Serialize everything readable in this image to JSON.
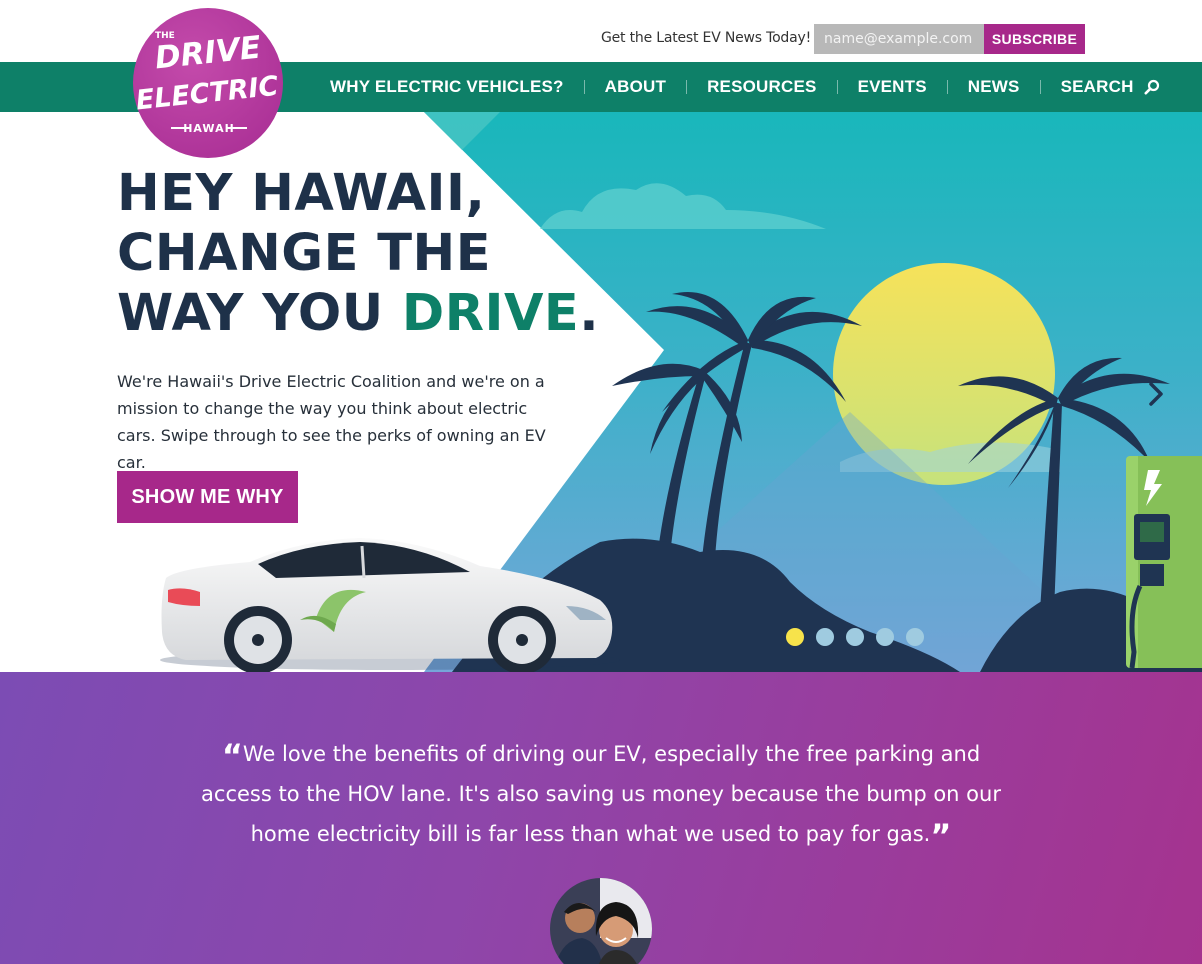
{
  "topbar": {
    "news_label": "Get the Latest EV News Today!",
    "email_placeholder": "name@example.com",
    "subscribe_label": "SUBSCRIBE"
  },
  "logo": {
    "line1": "DRIVE",
    "line2": "ELECTRIC",
    "line3": "HAWAII"
  },
  "nav": {
    "items": [
      {
        "label": "WHY ELECTRIC VEHICLES?"
      },
      {
        "label": "ABOUT"
      },
      {
        "label": "RESOURCES"
      },
      {
        "label": "EVENTS"
      },
      {
        "label": "NEWS"
      },
      {
        "label": "SEARCH"
      }
    ]
  },
  "hero": {
    "title_line1": "HEY HAWAII,",
    "title_line2": "CHANGE THE",
    "title_line3_a": "WAY YOU ",
    "title_line3_accent": "DRIVE",
    "title_line3_b": ".",
    "body": "We're Hawaii's Drive Electric Coalition and we're on a mission to change the way you think about electric cars. Swipe through to see the perks of owning an EV car.",
    "cta_label": "SHOW ME WHY",
    "slides_total": 5,
    "active_slide": 1
  },
  "testimonial": {
    "open_quote": "“",
    "text": "We love the benefits of driving our EV, especially the free parking and access to the HOV lane. It's also saving us money because the bump on our home electricity bill is far less than what we used to pay for gas.",
    "close_quote": "”"
  },
  "colors": {
    "brand_green": "#0e8068",
    "brand_magenta": "#a7288a",
    "navy": "#1e3149",
    "sun": "#f3e65a",
    "sky_top": "#1bb9bd",
    "sky_bottom": "#6aa9d6",
    "palm": "#1f3452",
    "charger": "#9ad26a"
  }
}
